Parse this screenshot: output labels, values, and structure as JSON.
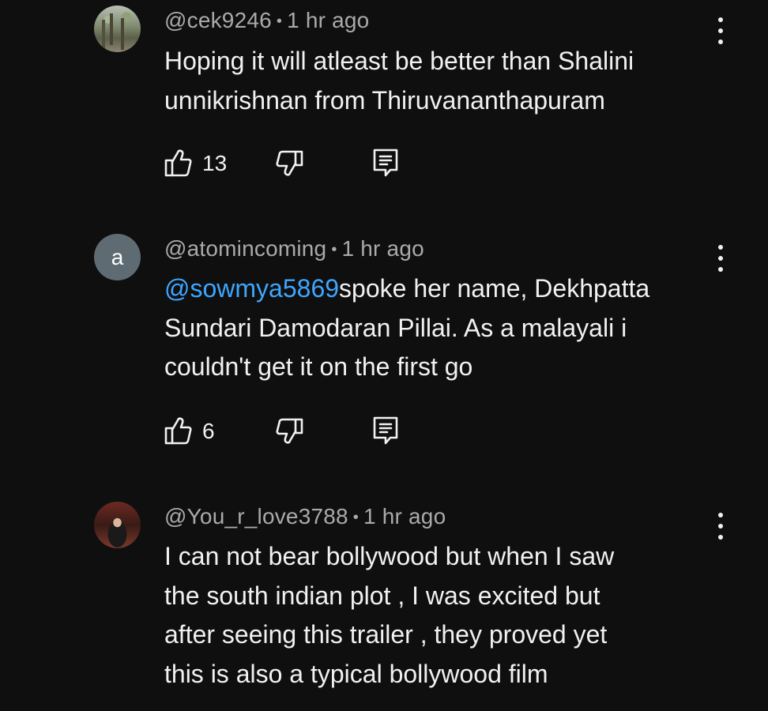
{
  "comments": [
    {
      "avatar_type": "photo",
      "author": "@cek9246",
      "time": "1 hr ago",
      "lines": [
        "Hoping it will atleast be better than Shalini",
        "unnikrishnan from Thiruvananthapuram"
      ],
      "likes": "13"
    },
    {
      "avatar_type": "letter",
      "avatar_letter": "a",
      "author": "@atomincoming",
      "time": "1 hr ago",
      "mention": "@sowmya5869",
      "first_line_rest": "spoke her name, Dekhpatta",
      "lines": [
        "Sundari Damodaran Pillai. As a malayali i",
        "couldn't get it on the first go"
      ],
      "likes": "6"
    },
    {
      "avatar_type": "photo",
      "author": "@You_r_love3788",
      "time": "1 hr ago",
      "lines": [
        "I can not bear bollywood but when I saw",
        "the south indian plot , I was excited but",
        "after seeing this trailer , they proved yet",
        "this is also a typical bollywood film"
      ]
    }
  ],
  "meta_separator": "•",
  "icons": {
    "like": "thumb-up-icon",
    "dislike": "thumb-down-icon",
    "reply": "reply-comment-icon",
    "menu": "more-vert-icon"
  },
  "colors": {
    "background": "#0f0f0f",
    "text": "#f1f1f1",
    "meta": "#aaaaaa",
    "mention": "#3ea6ff"
  }
}
